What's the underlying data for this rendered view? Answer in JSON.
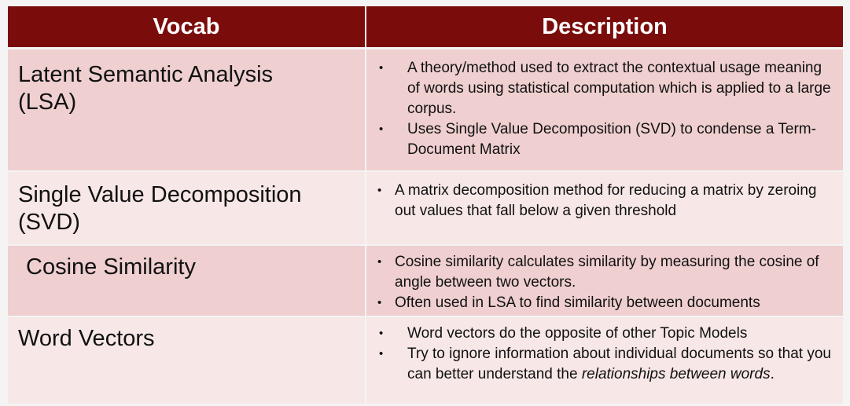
{
  "table": {
    "headers": {
      "vocab": "Vocab",
      "description": "Description"
    },
    "rows": [
      {
        "term_line1": "Latent Semantic Analysis",
        "term_line2": "(LSA)",
        "bullets": [
          "A theory/method used to extract the contextual usage meaning of words using statistical computation which is applied to a large corpus.",
          "Uses Single Value Decomposition (SVD) to condense a Term-Document Matrix"
        ]
      },
      {
        "term_line1": "Single Value Decomposition",
        "term_line2": "(SVD)",
        "bullets": [
          "A matrix decomposition method for reducing a matrix by zeroing out values that fall below a given threshold"
        ]
      },
      {
        "term_line1": "Cosine Similarity",
        "bullets": [
          "Cosine similarity calculates similarity by measuring the cosine of angle between two vectors.",
          "Often used in LSA to find similarity between documents"
        ]
      },
      {
        "term_line1": "Word Vectors",
        "bullets": [
          "Word vectors do the opposite of other Topic Models",
          "Try to ignore information about individual documents so that you can better understand the"
        ],
        "bullet2_italic": "relationships between words",
        "bullet2_end": "."
      }
    ],
    "bullet_symbol": "•"
  }
}
